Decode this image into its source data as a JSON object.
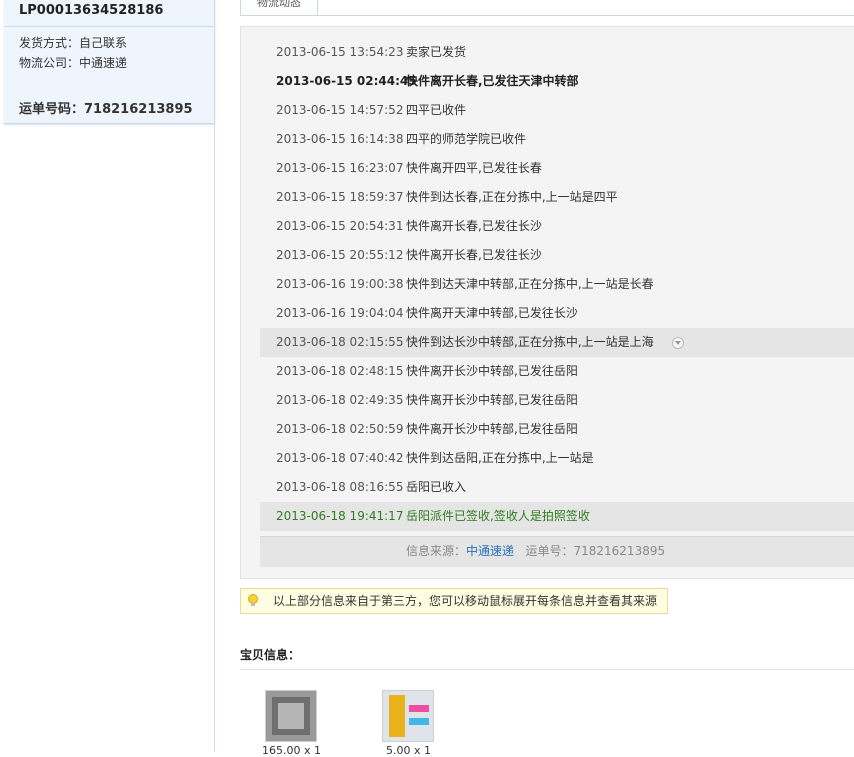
{
  "left": {
    "order_no": "LP00013634528186",
    "ship_method": "发货方式：自己联系",
    "carrier": "物流公司：中通速递",
    "waybill": "运单号码：718216213895"
  },
  "tab": {
    "label": "物流动态"
  },
  "tracking": [
    {
      "time": "2013-06-15 13:54:23",
      "desc": "卖家已发货"
    },
    {
      "time": "2013-06-15 02:44:45",
      "desc": "快件离开长春,已发往天津中转部"
    },
    {
      "time": "2013-06-15 14:57:52",
      "desc": "四平已收件"
    },
    {
      "time": "2013-06-15 16:14:38",
      "desc": "四平的师范学院已收件"
    },
    {
      "time": "2013-06-15 16:23:07",
      "desc": "快件离开四平,已发往长春"
    },
    {
      "time": "2013-06-15 18:59:37",
      "desc": "快件到达长春,正在分拣中,上一站是四平"
    },
    {
      "time": "2013-06-15 20:54:31",
      "desc": "快件离开长春,已发往长沙"
    },
    {
      "time": "2013-06-15 20:55:12",
      "desc": "快件离开长春,已发往长沙"
    },
    {
      "time": "2013-06-16 19:00:38",
      "desc": "快件到达天津中转部,正在分拣中,上一站是长春"
    },
    {
      "time": "2013-06-16 19:04:04",
      "desc": "快件离开天津中转部,已发往长沙"
    },
    {
      "time": "2013-06-18 02:15:55",
      "desc": "快件到达长沙中转部,正在分拣中,上一站是上海"
    },
    {
      "time": "2013-06-18 02:48:15",
      "desc": "快件离开长沙中转部,已发往岳阳"
    },
    {
      "time": "2013-06-18 02:49:35",
      "desc": "快件离开长沙中转部,已发往岳阳"
    },
    {
      "time": "2013-06-18 02:50:59",
      "desc": "快件离开长沙中转部,已发往岳阳"
    },
    {
      "time": "2013-06-18 07:40:42",
      "desc": "快件到达岳阳,正在分拣中,上一站是"
    },
    {
      "time": "2013-06-18 08:16:55",
      "desc": "岳阳已收入"
    },
    {
      "time": "2013-06-18 19:41:17",
      "desc": "岳阳派件已签收,签收人是拍照签收"
    }
  ],
  "source": {
    "label": "信息来源：",
    "carrier": "中通速递",
    "waybill_label": "运单号：718216213895"
  },
  "tip": "以上部分信息来自于第三方，您可以移动鼠标展开每条信息并查看其来源",
  "items_title": "宝贝信息：",
  "items": [
    {
      "price": "165.00 x 1"
    },
    {
      "price": "5.00 x 1"
    }
  ]
}
